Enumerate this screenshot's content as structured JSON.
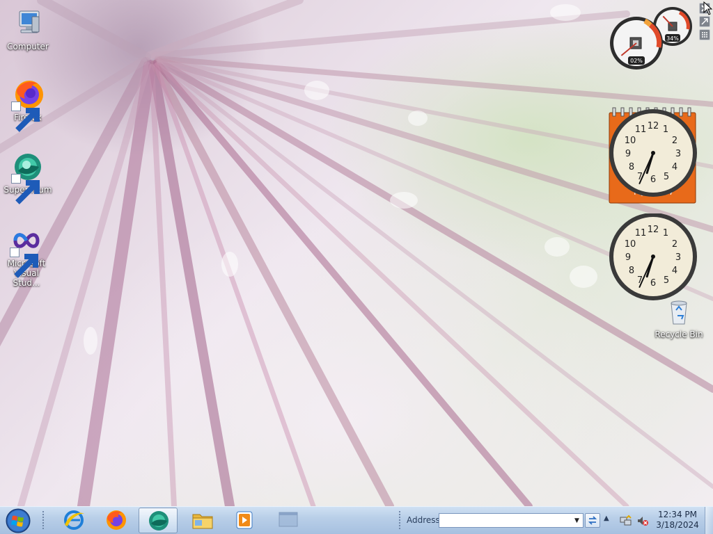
{
  "desktop": {
    "icons": [
      {
        "label": "Computer",
        "icon": "computer-icon"
      },
      {
        "label": "Firefox",
        "icon": "firefox-icon"
      },
      {
        "label": "Supermium",
        "icon": "supermium-icon"
      },
      {
        "label": "Microsoft Visual Stud...",
        "icon": "visual-studio-icon"
      },
      {
        "label": "Recycle Bin",
        "icon": "recycle-bin-icon"
      }
    ]
  },
  "gadgets": {
    "cpu_meter": {
      "cpu_percent": 2,
      "memory_percent": 34,
      "cpu_label": "02%",
      "memory_label": "34%"
    },
    "calendar_clock": {
      "hour": 6,
      "minute": 34,
      "date_text": "M[?] 2024"
    },
    "clock": {
      "hour": 6,
      "minute": 34
    }
  },
  "taskbar": {
    "start_icon": "windows-logo-icon",
    "quick_launch": [
      {
        "name": "internet-explorer",
        "icon": "internet-explorer-icon"
      },
      {
        "name": "firefox",
        "icon": "firefox-icon"
      },
      {
        "name": "supermium",
        "icon": "supermium-icon",
        "active": true
      },
      {
        "name": "file-explorer",
        "icon": "folder-icon"
      },
      {
        "name": "media-player",
        "icon": "media-player-icon"
      },
      {
        "name": "window",
        "icon": "window-icon"
      }
    ],
    "address": {
      "label": "Address",
      "value": ""
    },
    "tray": {
      "icons": [
        "network-icon",
        "volume-muted-icon"
      ],
      "time": "12:34 PM",
      "date": "3/18/2024"
    }
  },
  "colors": {
    "taskbar": "#b9cfe8",
    "calendar_gadget": "#e86a1a",
    "accent": "#3c6fb0"
  }
}
